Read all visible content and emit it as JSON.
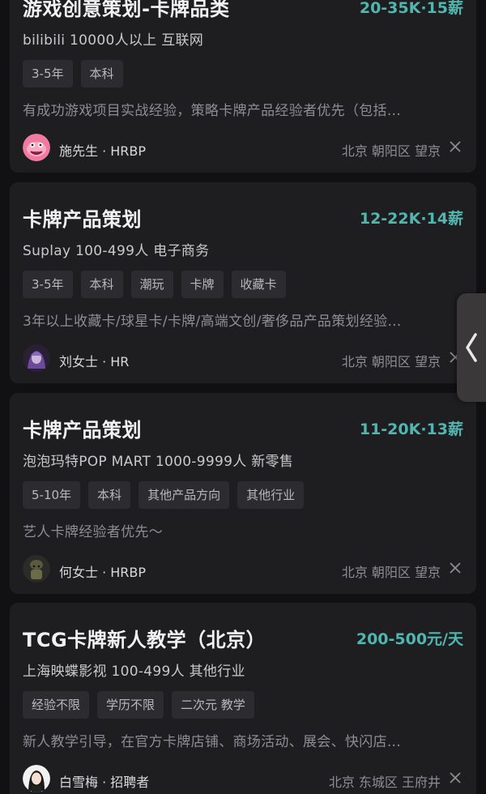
{
  "jobs": [
    {
      "title": "游戏创意策划-卡牌品类",
      "salary": "20-35K·15薪",
      "company": "bilibili 10000人以上 互联网",
      "tags": [
        "3-5年",
        "本科"
      ],
      "desc": "有成功游戏项目实战经验，策略卡牌产品经验者优先（包括…",
      "recruiter": "施先生 · HRBP",
      "location": "北京 朝阳区 望京",
      "avatar_color": "#f07aa0"
    },
    {
      "title": "卡牌产品策划",
      "salary": "12-22K·14薪",
      "company": "Suplay 100-499人 电子商务",
      "tags": [
        "3-5年",
        "本科",
        "潮玩",
        "卡牌",
        "收藏卡"
      ],
      "desc": "3年以上收藏卡/球星卡/卡牌/高端文创/奢侈品产品策划经验…",
      "recruiter": "刘女士 · HR",
      "location": "北京 朝阳区 望京",
      "avatar_color": "#6a4a9a"
    },
    {
      "title": "卡牌产品策划",
      "salary": "11-20K·13薪",
      "company": "泡泡玛特POP MART 1000-9999人 新零售",
      "tags": [
        "5-10年",
        "本科",
        "其他产品方向",
        "其他行业"
      ],
      "desc": "艺人卡牌经验者优先～",
      "recruiter": "何女士 · HRBP",
      "location": "北京 朝阳区 望京",
      "avatar_color": "#4a4a3a"
    },
    {
      "title": "TCG卡牌新人教学（北京）",
      "salary": "200-500元/天",
      "company": "上海映蝶影视 100-499人 其他行业",
      "tags": [
        "经验不限",
        "学历不限",
        "二次元 教学"
      ],
      "desc": "新人教学引导，在官方卡牌店铺、商场活动、展会、快闪店…",
      "recruiter": "白雪梅 · 招聘者",
      "location": "北京 东城区 王府井",
      "avatar_color": "#e8e8e8"
    }
  ],
  "icons": {
    "close": "close-icon",
    "handle": "chevron-left-icon"
  },
  "colors": {
    "salary": "#4fb6b0",
    "card_bg": "#1e1e21",
    "tag_bg": "#2c2c30"
  }
}
